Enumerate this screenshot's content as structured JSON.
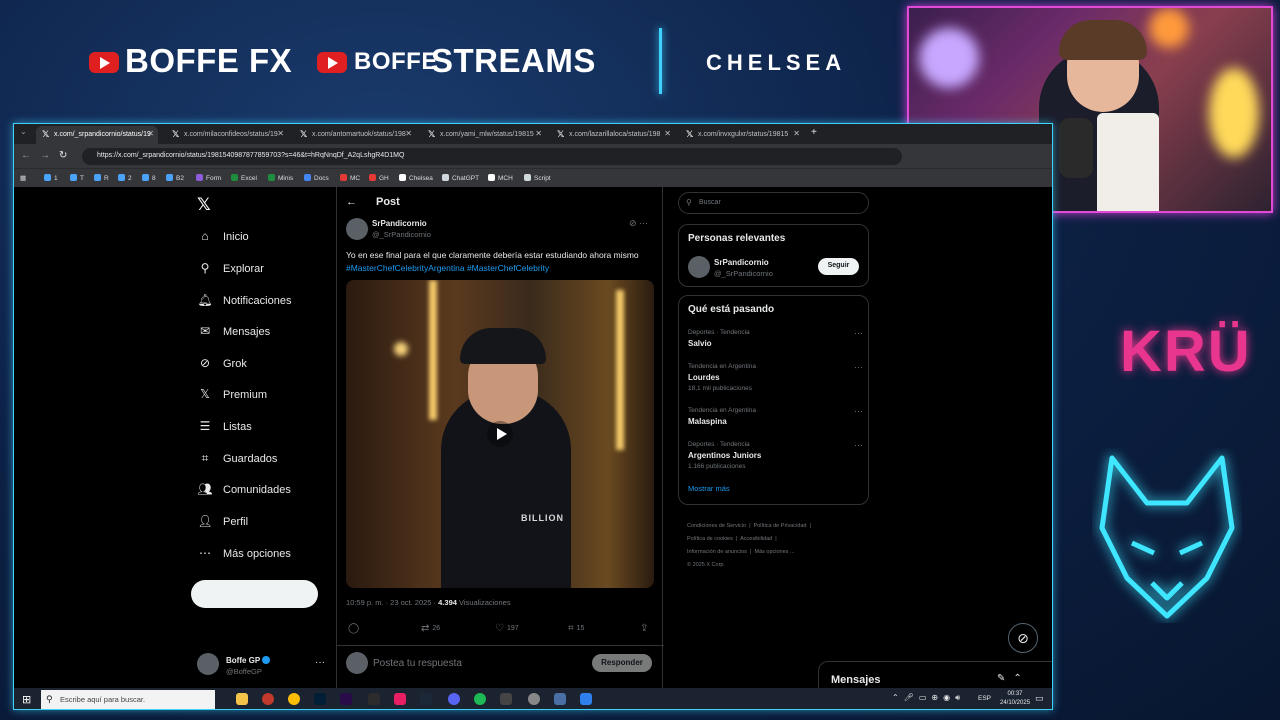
{
  "overlay": {
    "brand1": "BOFFE FX",
    "brand2_prefix": "BOFFE",
    "brand2_main": "STREAMS",
    "guest": "CHELSEA",
    "accent_color": "#3fd2ff",
    "kru_logo_text": "KRÜ"
  },
  "browser": {
    "tabs": [
      {
        "label": "x.com/_srpandicornio/status/19",
        "active": true
      },
      {
        "label": "x.com/milaconfideos/status/19",
        "active": false
      },
      {
        "label": "x.com/antomartuok/status/198",
        "active": false
      },
      {
        "label": "x.com/yami_mlw/status/19815",
        "active": false
      },
      {
        "label": "x.com/lazarillaloca/status/198",
        "active": false
      },
      {
        "label": "x.com/invxgulxr/status/19815",
        "active": false
      }
    ],
    "url": "https://x.com/_srpandicornio/status/1981540987877859703?s=46&t=hRqNnqDf_A2qLshgR4D1MQ",
    "bookmarks": [
      "1",
      "T",
      "R",
      "2",
      "8",
      "B2",
      "Form",
      "Excel",
      "Minis",
      "Docs",
      "MC",
      "GH",
      "Chelsea",
      "ChatGPT",
      "MCH",
      "Script"
    ]
  },
  "sidebar": {
    "items": [
      {
        "label": "Inicio",
        "icon": "home-icon"
      },
      {
        "label": "Explorar",
        "icon": "search-icon"
      },
      {
        "label": "Notificaciones",
        "icon": "bell-icon"
      },
      {
        "label": "Mensajes",
        "icon": "mail-icon"
      },
      {
        "label": "Grok",
        "icon": "grok-icon"
      },
      {
        "label": "Premium",
        "icon": "x-icon"
      },
      {
        "label": "Listas",
        "icon": "list-icon"
      },
      {
        "label": "Guardados",
        "icon": "bookmark-icon"
      },
      {
        "label": "Comunidades",
        "icon": "people-icon"
      },
      {
        "label": "Perfil",
        "icon": "person-icon"
      },
      {
        "label": "Más opciones",
        "icon": "more-circle-icon"
      }
    ],
    "account": {
      "name": "Boffe GP",
      "handle": "@BoffeGP"
    }
  },
  "post": {
    "header_title": "Post",
    "author_name": "SrPandicornio",
    "author_handle": "@_SrPandicornio",
    "text_plain": "Yo en ese final para el que claramente debería estar estudiando ahora mismo ",
    "hashtags": "#MasterChefCelebrityArgentina #MasterChefCelebrity",
    "media_label": "BILLION",
    "time": "10:59 p. m. · 23 oct. 2025 · ",
    "views_count": "4.394",
    "views_label": " Visualizaciones",
    "stats": {
      "retweets": "26",
      "likes": "197",
      "bookmarks": "15"
    },
    "reply_placeholder": "Postea tu respuesta",
    "reply_button": "Responder"
  },
  "right": {
    "search_placeholder": "Buscar",
    "relevant_title": "Personas relevantes",
    "relevant_name": "SrPandicornio",
    "relevant_handle": "@_SrPandicornio",
    "follow_label": "Seguir",
    "trends_title": "Qué está pasando",
    "trends": [
      {
        "category": "Deportes · Tendencia",
        "name": "Salvio",
        "count": ""
      },
      {
        "category": "Tendencia en Argentina",
        "name": "Lourdes",
        "count": "18,1 mil publicaciones"
      },
      {
        "category": "Tendencia en Argentina",
        "name": "Malaspina",
        "count": ""
      },
      {
        "category": "Deportes · Tendencia",
        "name": "Argentinos Juniors",
        "count": "1.166 publicaciones"
      }
    ],
    "show_more": "Mostrar más",
    "footer": [
      "Condiciones de Servicio",
      "Política de Privacidad",
      "Política de cookies",
      "Accesibilidad",
      "Información de anuncios",
      "Más opciones ...",
      "© 2025 X Corp."
    ]
  },
  "messages_drawer": {
    "title": "Mensajes"
  },
  "taskbar": {
    "search_placeholder": "Escribe aquí para buscar.",
    "lang": "ESP",
    "time": "00:37",
    "date": "24/10/2025"
  }
}
